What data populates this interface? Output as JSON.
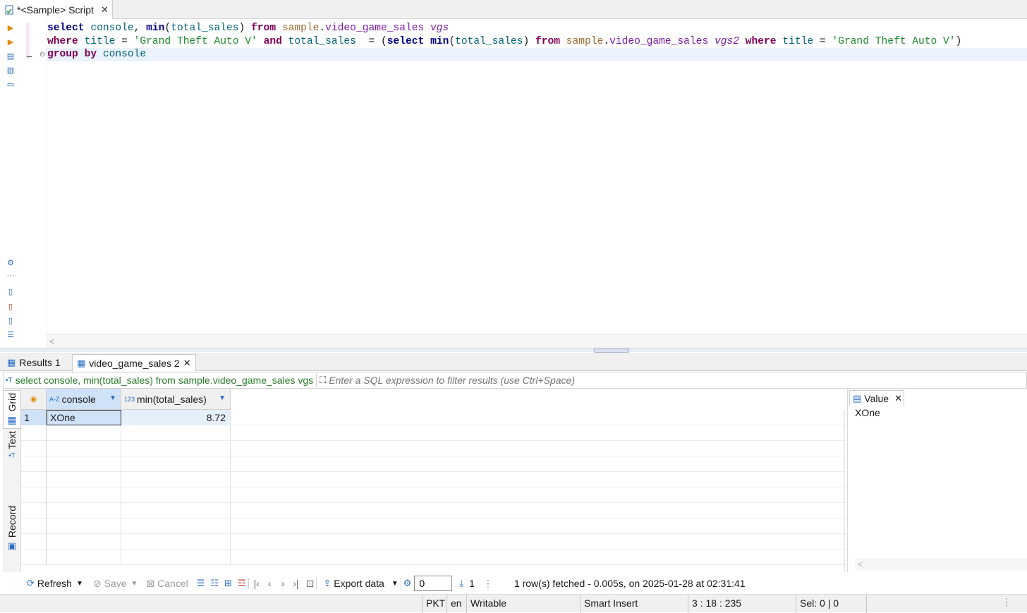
{
  "editor": {
    "tab_title": "*<Sample> Script",
    "lines": [
      [
        [
          "kwb",
          "select"
        ],
        [
          "plain",
          " "
        ],
        [
          "id",
          "console"
        ],
        [
          "plain",
          ", "
        ],
        [
          "kwb",
          "min"
        ],
        [
          "plain",
          "("
        ],
        [
          "id",
          "total_sales"
        ],
        [
          "plain",
          ") "
        ],
        [
          "kw",
          "from"
        ],
        [
          "plain",
          " "
        ],
        [
          "schema",
          "sample"
        ],
        [
          "plain",
          "."
        ],
        [
          "tbl",
          "video_game_sales"
        ],
        [
          "plain",
          " "
        ],
        [
          "alias",
          "vgs"
        ]
      ],
      [
        [
          "kw",
          "where"
        ],
        [
          "plain",
          " "
        ],
        [
          "id",
          "title"
        ],
        [
          "plain",
          " = "
        ],
        [
          "str",
          "'Grand Theft Auto V'"
        ],
        [
          "plain",
          " "
        ],
        [
          "kw",
          "and"
        ],
        [
          "plain",
          " "
        ],
        [
          "id",
          "total_sales"
        ],
        [
          "plain",
          "  = ("
        ],
        [
          "kwb",
          "select"
        ],
        [
          "plain",
          " "
        ],
        [
          "kwb",
          "min"
        ],
        [
          "plain",
          "("
        ],
        [
          "id",
          "total_sales"
        ],
        [
          "plain",
          ") "
        ],
        [
          "kw",
          "from"
        ],
        [
          "plain",
          " "
        ],
        [
          "schema",
          "sample"
        ],
        [
          "plain",
          "."
        ],
        [
          "tbl",
          "video_game_sales"
        ],
        [
          "plain",
          " "
        ],
        [
          "alias",
          "vgs2"
        ],
        [
          "plain",
          " "
        ],
        [
          "kw",
          "where"
        ],
        [
          "plain",
          " "
        ],
        [
          "id",
          "title"
        ],
        [
          "plain",
          " = "
        ],
        [
          "str",
          "'Grand Theft Auto V'"
        ],
        [
          "plain",
          ")"
        ]
      ],
      [
        [
          "kw",
          "group"
        ],
        [
          "plain",
          " "
        ],
        [
          "kw",
          "by"
        ],
        [
          "plain",
          " "
        ],
        [
          "id",
          "console"
        ]
      ]
    ]
  },
  "results": {
    "tabs": [
      {
        "label": "Results 1"
      },
      {
        "label": "video_game_sales 2"
      }
    ],
    "query_text": "select console, min(total_sales) from sample.video_game_sales vgs",
    "filter_placeholder": "Enter a SQL expression to filter results (use Ctrl+Space)",
    "side_tabs": {
      "grid": "Grid",
      "text": "Text",
      "record": "Record"
    },
    "columns": [
      {
        "type_tag": "A-Z",
        "name": "console"
      },
      {
        "type_tag": "123",
        "name": "min(total_sales)"
      }
    ],
    "rows": [
      {
        "num": "1",
        "console": "XOne",
        "min_total_sales": "8.72"
      }
    ],
    "value_panel": {
      "title": "Value",
      "value": "XOne"
    }
  },
  "toolbar": {
    "refresh": "Refresh",
    "save": "Save",
    "cancel": "Cancel",
    "export": "Export data",
    "limit_value": "0",
    "row_count": "1",
    "status_message": "1 row(s) fetched - 0.005s, on 2025-01-28 at 02:31:41"
  },
  "statusbar": {
    "timezone": "PKT",
    "locale": "en",
    "mode": "Writable",
    "insert_mode": "Smart Insert",
    "position": "3 : 18 : 235",
    "selection": "Sel: 0 | 0"
  },
  "colors": {
    "keyword": "#7f0055",
    "keyword_func": "#00007f",
    "identifier": "#00627a",
    "string": "#1e8a2e",
    "selection": "#cfe2f7"
  }
}
